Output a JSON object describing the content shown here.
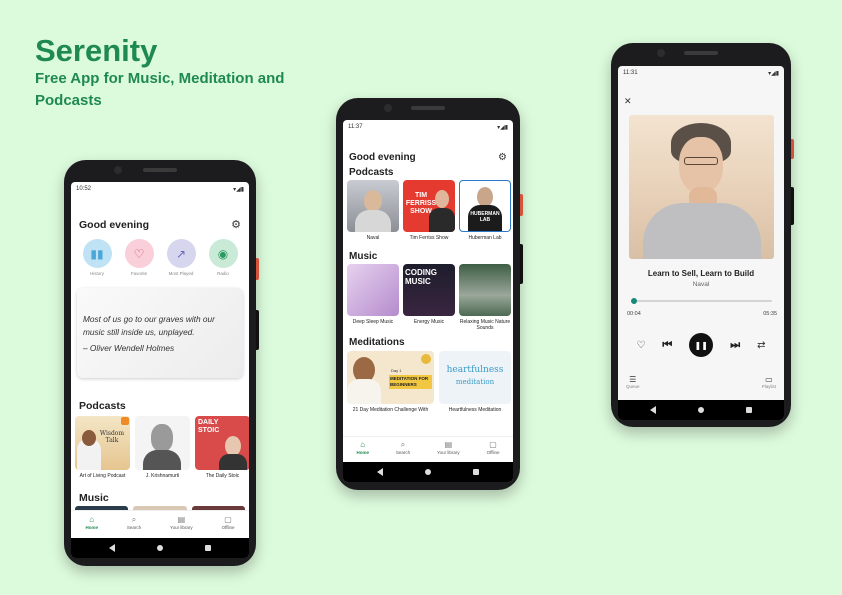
{
  "hero": {
    "title": "Serenity",
    "subtitle": "Free App for Music, Meditation and Podcasts"
  },
  "colors": {
    "brand": "#1f8a4f",
    "background": "#dcfadc",
    "play_button": "#111111",
    "progress": "#168a7a"
  },
  "phone1": {
    "status_time": "10:52",
    "greeting": "Good evening",
    "quick_actions": [
      {
        "label": "History",
        "icon": "chart-bars-icon",
        "color": "#bfe3f5"
      },
      {
        "label": "Favorite",
        "icon": "heart-icon",
        "color": "#f9cfd9"
      },
      {
        "label": "Most Played",
        "icon": "trending-icon",
        "color": "#d7d6ef"
      },
      {
        "label": "Radio",
        "icon": "radio-icon",
        "color": "#c9ead7"
      }
    ],
    "quote": "Most of us go to our graves with our music still inside us, unplayed.",
    "quote_author": "– Oliver Wendell Holmes",
    "podcasts_heading": "Podcasts",
    "podcasts": [
      {
        "caption": "Art of Living Podcast",
        "art_text": "Wisdom Talk"
      },
      {
        "caption": "J. Krishnamurti",
        "art_text": ""
      },
      {
        "caption": "The Daily Stoic",
        "art_text": "DAILY STOIC"
      }
    ],
    "music_heading": "Music",
    "tabs": [
      "Home",
      "Search",
      "Your library",
      "Offline"
    ]
  },
  "phone2": {
    "status_time": "11:37",
    "greeting": "Good evening",
    "podcasts_heading": "Podcasts",
    "podcasts": [
      {
        "caption": "Naval",
        "art_text": ""
      },
      {
        "caption": "Tim Ferriss Show",
        "art_text": "TIM FERRISS SHOW"
      },
      {
        "caption": "Huberman Lab",
        "art_text": "HUBERMAN LAB"
      }
    ],
    "music_heading": "Music",
    "music": [
      {
        "caption": "Deep Sleep Music",
        "art_text": ""
      },
      {
        "caption": "Energy Music",
        "art_text": "CODING MUSIC"
      },
      {
        "caption": "Relaxing Music Nature Sounds",
        "art_text": ""
      }
    ],
    "meditations_heading": "Meditations",
    "meditations": [
      {
        "caption": "21 Day Meditation Challenge With",
        "art_top": "Day 1",
        "art_text": "MEDITATION FOR BEGINNERS"
      },
      {
        "caption": "Heartfulness Meditation",
        "art_top": "heartfulness",
        "art_text": "meditation"
      }
    ],
    "tabs": [
      "Home",
      "Search",
      "Your library",
      "Offline"
    ]
  },
  "phone3": {
    "status_time": "11:31",
    "track_title": "Learn to Sell, Learn to Build",
    "track_artist": "Naval",
    "elapsed": "00:04",
    "duration": "05:35",
    "progress": 0.012,
    "queue_label": "Queue",
    "playlist_label": "Playlist"
  }
}
